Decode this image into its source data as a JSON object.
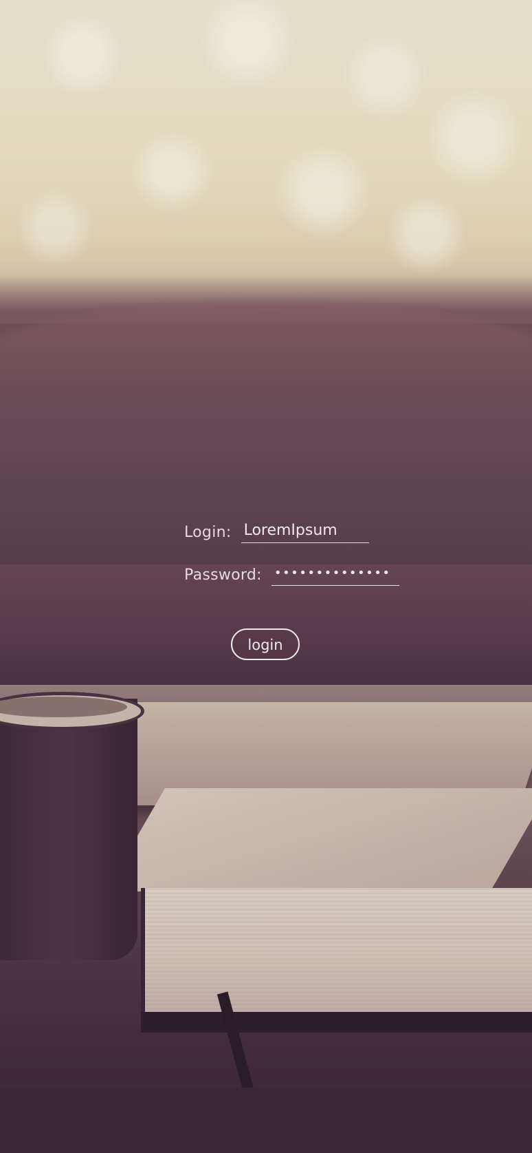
{
  "form": {
    "login_label": "Login:",
    "login_value": "LoremIpsum",
    "password_label": "Password:",
    "password_value": "••••••••••••••",
    "button_label": "login"
  },
  "background": {
    "description_icon": "coffee-and-book-photo"
  },
  "colors": {
    "text": "#e6dde0",
    "underline": "#e8dfe3",
    "button_border": "#f1eaed"
  }
}
